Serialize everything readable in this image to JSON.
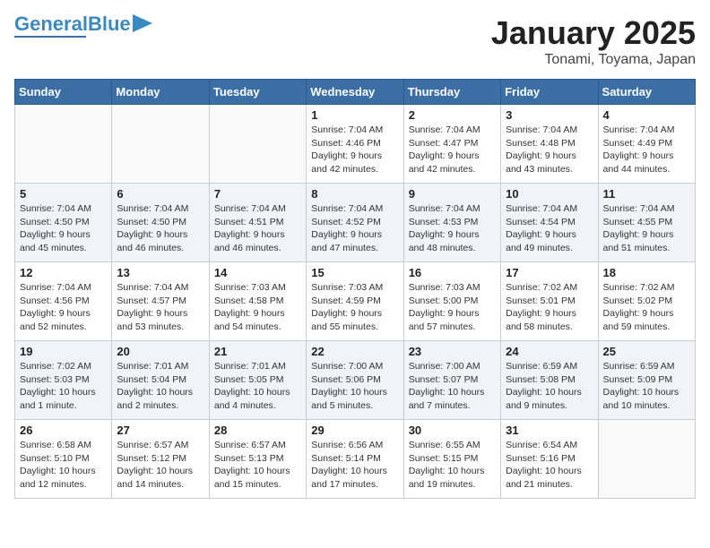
{
  "header": {
    "logo_general": "General",
    "logo_blue": "Blue",
    "month_title": "January 2025",
    "location": "Tonami, Toyama, Japan"
  },
  "weekdays": [
    "Sunday",
    "Monday",
    "Tuesday",
    "Wednesday",
    "Thursday",
    "Friday",
    "Saturday"
  ],
  "weeks": [
    [
      {
        "day": "",
        "info": ""
      },
      {
        "day": "",
        "info": ""
      },
      {
        "day": "",
        "info": ""
      },
      {
        "day": "1",
        "info": "Sunrise: 7:04 AM\nSunset: 4:46 PM\nDaylight: 9 hours\nand 42 minutes."
      },
      {
        "day": "2",
        "info": "Sunrise: 7:04 AM\nSunset: 4:47 PM\nDaylight: 9 hours\nand 42 minutes."
      },
      {
        "day": "3",
        "info": "Sunrise: 7:04 AM\nSunset: 4:48 PM\nDaylight: 9 hours\nand 43 minutes."
      },
      {
        "day": "4",
        "info": "Sunrise: 7:04 AM\nSunset: 4:49 PM\nDaylight: 9 hours\nand 44 minutes."
      }
    ],
    [
      {
        "day": "5",
        "info": "Sunrise: 7:04 AM\nSunset: 4:50 PM\nDaylight: 9 hours\nand 45 minutes."
      },
      {
        "day": "6",
        "info": "Sunrise: 7:04 AM\nSunset: 4:50 PM\nDaylight: 9 hours\nand 46 minutes."
      },
      {
        "day": "7",
        "info": "Sunrise: 7:04 AM\nSunset: 4:51 PM\nDaylight: 9 hours\nand 46 minutes."
      },
      {
        "day": "8",
        "info": "Sunrise: 7:04 AM\nSunset: 4:52 PM\nDaylight: 9 hours\nand 47 minutes."
      },
      {
        "day": "9",
        "info": "Sunrise: 7:04 AM\nSunset: 4:53 PM\nDaylight: 9 hours\nand 48 minutes."
      },
      {
        "day": "10",
        "info": "Sunrise: 7:04 AM\nSunset: 4:54 PM\nDaylight: 9 hours\nand 49 minutes."
      },
      {
        "day": "11",
        "info": "Sunrise: 7:04 AM\nSunset: 4:55 PM\nDaylight: 9 hours\nand 51 minutes."
      }
    ],
    [
      {
        "day": "12",
        "info": "Sunrise: 7:04 AM\nSunset: 4:56 PM\nDaylight: 9 hours\nand 52 minutes."
      },
      {
        "day": "13",
        "info": "Sunrise: 7:04 AM\nSunset: 4:57 PM\nDaylight: 9 hours\nand 53 minutes."
      },
      {
        "day": "14",
        "info": "Sunrise: 7:03 AM\nSunset: 4:58 PM\nDaylight: 9 hours\nand 54 minutes."
      },
      {
        "day": "15",
        "info": "Sunrise: 7:03 AM\nSunset: 4:59 PM\nDaylight: 9 hours\nand 55 minutes."
      },
      {
        "day": "16",
        "info": "Sunrise: 7:03 AM\nSunset: 5:00 PM\nDaylight: 9 hours\nand 57 minutes."
      },
      {
        "day": "17",
        "info": "Sunrise: 7:02 AM\nSunset: 5:01 PM\nDaylight: 9 hours\nand 58 minutes."
      },
      {
        "day": "18",
        "info": "Sunrise: 7:02 AM\nSunset: 5:02 PM\nDaylight: 9 hours\nand 59 minutes."
      }
    ],
    [
      {
        "day": "19",
        "info": "Sunrise: 7:02 AM\nSunset: 5:03 PM\nDaylight: 10 hours\nand 1 minute."
      },
      {
        "day": "20",
        "info": "Sunrise: 7:01 AM\nSunset: 5:04 PM\nDaylight: 10 hours\nand 2 minutes."
      },
      {
        "day": "21",
        "info": "Sunrise: 7:01 AM\nSunset: 5:05 PM\nDaylight: 10 hours\nand 4 minutes."
      },
      {
        "day": "22",
        "info": "Sunrise: 7:00 AM\nSunset: 5:06 PM\nDaylight: 10 hours\nand 5 minutes."
      },
      {
        "day": "23",
        "info": "Sunrise: 7:00 AM\nSunset: 5:07 PM\nDaylight: 10 hours\nand 7 minutes."
      },
      {
        "day": "24",
        "info": "Sunrise: 6:59 AM\nSunset: 5:08 PM\nDaylight: 10 hours\nand 9 minutes."
      },
      {
        "day": "25",
        "info": "Sunrise: 6:59 AM\nSunset: 5:09 PM\nDaylight: 10 hours\nand 10 minutes."
      }
    ],
    [
      {
        "day": "26",
        "info": "Sunrise: 6:58 AM\nSunset: 5:10 PM\nDaylight: 10 hours\nand 12 minutes."
      },
      {
        "day": "27",
        "info": "Sunrise: 6:57 AM\nSunset: 5:12 PM\nDaylight: 10 hours\nand 14 minutes."
      },
      {
        "day": "28",
        "info": "Sunrise: 6:57 AM\nSunset: 5:13 PM\nDaylight: 10 hours\nand 15 minutes."
      },
      {
        "day": "29",
        "info": "Sunrise: 6:56 AM\nSunset: 5:14 PM\nDaylight: 10 hours\nand 17 minutes."
      },
      {
        "day": "30",
        "info": "Sunrise: 6:55 AM\nSunset: 5:15 PM\nDaylight: 10 hours\nand 19 minutes."
      },
      {
        "day": "31",
        "info": "Sunrise: 6:54 AM\nSunset: 5:16 PM\nDaylight: 10 hours\nand 21 minutes."
      },
      {
        "day": "",
        "info": ""
      }
    ]
  ]
}
